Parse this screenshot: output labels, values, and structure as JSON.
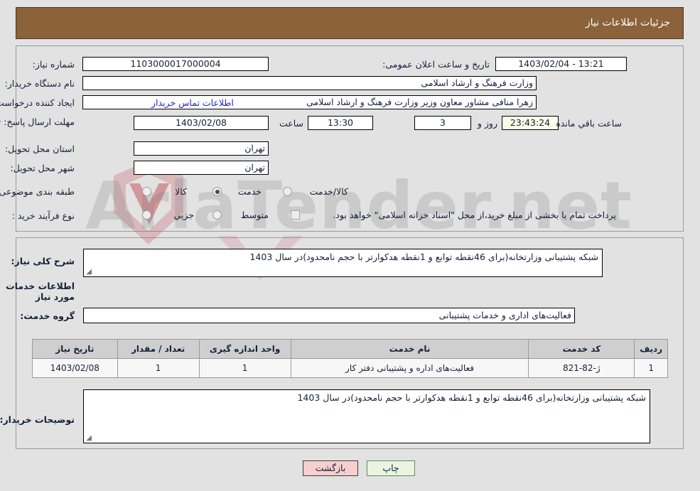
{
  "header": {
    "title": "جزئیات اطلاعات نیاز"
  },
  "top_panel": {
    "need_number_label": "شماره نیاز:",
    "need_number_value": "1103000017000004",
    "public_announce_label": "تاریخ و ساعت اعلان عمومی:",
    "public_announce_value": "13:21 - 1403/02/04",
    "buyer_org_label": "نام دستگاه خریدار:",
    "buyer_org_value": "وزارت فرهنگ و ارشاد اسلامی",
    "requester_label": "ایجاد کننده درخواست:",
    "requester_value": "زهرا منافی مشاور معاون وزیر وزارت فرهنگ و ارشاد اسلامی",
    "contact_link": "اطلاعات تماس خریدار",
    "deadline_label": "مهلت ارسال پاسخ: تا تاریخ:",
    "deadline_date": "1403/02/08",
    "time_word": "ساعت",
    "deadline_time": "13:30",
    "days_value": "3",
    "days_word": "روز و",
    "countdown_value": "23:43:24",
    "remaining_word": "ساعت باقي مانده",
    "province_label": "استان محل تحویل:",
    "province_value": "تهران",
    "city_label": "شهر محل تحویل:",
    "city_value": "تهران",
    "category_label": "طبقه بندی موضوعی:",
    "category_options": [
      {
        "label": "کالا",
        "selected": false
      },
      {
        "label": "خدمت",
        "selected": true
      },
      {
        "label": "کالا/خدمت",
        "selected": false
      }
    ],
    "process_label": "نوع فرآیند خرید :",
    "process_options": [
      {
        "label": "جزیي",
        "selected": false
      },
      {
        "label": "متوسط",
        "selected": false
      }
    ],
    "treasury_checkbox_label": "پرداخت تمام یا بخشی از مبلغ خرید،از محل \"اسناد خزانه اسلامی\" خواهد بود.",
    "treasury_checked": false
  },
  "mid_panel": {
    "general_desc_label": "شرح کلی نیاز:",
    "general_desc_value": "شبکه پشتیبانی وزارتخانه(برای 46نقطه توابع و 1نقطه هدکوارتر با حجم نامحدود)در سال 1403",
    "services_section_title": "اطلاعات خدمات مورد نیاز",
    "service_group_label": "گروه خدمت:",
    "service_group_value": "فعالیت‌های اداری و خدمات پشتیبانی",
    "buyer_notes_label": "توضیحات خریدار:",
    "buyer_notes_value": "شبکه پشتیبانی وزارتخانه(برای 46نقطه توابع و 1نقطه هدکوارتر با حجم نامحدود)در سال 1403"
  },
  "items_table": {
    "columns": [
      "ردیف",
      "کد خدمت",
      "نام خدمت",
      "واحد اندازه گیری",
      "تعداد / مقدار",
      "تاریخ نیاز"
    ],
    "rows": [
      {
        "row_no": "1",
        "service_code": "ژ-82-821",
        "service_name": "فعالیت‌های اداره و پشتیبانی دفتر کار",
        "unit": "1",
        "quantity": "1",
        "need_date": "1403/02/08"
      }
    ]
  },
  "footer": {
    "back_label": "بازگشت",
    "print_label": "چاپ"
  },
  "watermark": {
    "text": "AriaTender.net"
  },
  "colors": {
    "header_bg": "#8b6239",
    "page_bg": "#e2e2e2",
    "link": "#2222dd",
    "countdown_bg": "#fbfbe8",
    "back_btn_bg": "#f8cfcf",
    "print_btn_bg": "#e9f5e2"
  }
}
